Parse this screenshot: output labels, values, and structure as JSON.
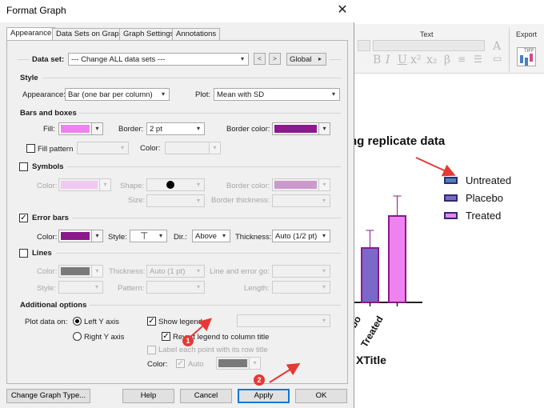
{
  "dialog": {
    "title": "Format Graph",
    "tabs": [
      "Appearance",
      "Data Sets on Graph",
      "Graph Settings",
      "Annotations"
    ],
    "dataset": {
      "label": "Data set:",
      "value": "--- Change ALL data sets ---",
      "prev": "<",
      "next": ">",
      "scope": "Global"
    },
    "style": {
      "heading": "Style",
      "appearance_label": "Appearance:",
      "appearance_value": "Bar (one bar per column)",
      "plot_label": "Plot:",
      "plot_value": "Mean with SD"
    },
    "bars": {
      "heading": "Bars and boxes",
      "fill_label": "Fill:",
      "fill_color": "#ee82ee",
      "border_label": "Border:",
      "border_value": "2 pt",
      "border_color_label": "Border color:",
      "border_color": "#8b1a8b",
      "fill_pattern_label": "Fill pattern",
      "color_label": "Color:"
    },
    "symbols": {
      "heading": "Symbols",
      "color_label": "Color:",
      "color": "#f0c8f0",
      "shape_label": "Shape:",
      "size_label": "Size:",
      "border_color_label": "Border color:",
      "border_color": "#cc99cc",
      "border_thickness_label": "Border thickness:"
    },
    "error_bars": {
      "heading": "Error bars",
      "color_label": "Color:",
      "color": "#8b1a8b",
      "style_label": "Style:",
      "dir_label": "Dir.:",
      "dir_value": "Above",
      "thickness_label": "Thickness:",
      "thickness_value": "Auto (1/2 pt)"
    },
    "lines": {
      "heading": "Lines",
      "color_label": "Color:",
      "thickness_label": "Thickness:",
      "thickness_value": "Auto (1 pt)",
      "line_error_label": "Line and error go:",
      "style_label": "Style:",
      "pattern_label": "Pattern:",
      "length_label": "Length:"
    },
    "additional": {
      "heading": "Additional options",
      "plot_on_label": "Plot data on:",
      "left_y": "Left Y axis",
      "right_y": "Right  Y axis",
      "show_legend": "Show legend",
      "revert_legend": "Revert legend to column title",
      "label_points": "Label each point with its row title",
      "color_label": "Color:",
      "auto_label": "Auto"
    },
    "buttons": {
      "change_type": "Change Graph Type...",
      "help": "Help",
      "cancel": "Cancel",
      "apply": "Apply",
      "ok": "OK"
    },
    "badges": [
      "1",
      "2"
    ]
  },
  "app": {
    "ribbon": {
      "text_group": "Text",
      "export_group": "Export",
      "export_icon_text": "TIFF"
    },
    "chart_title": "ng replicate data",
    "x_title": "XTitle",
    "legend": [
      {
        "name": "Untreated",
        "color": "#4f81bd"
      },
      {
        "name": "Placebo",
        "color": "#7b68c8"
      },
      {
        "name": "Treated",
        "color": "#ee82ee"
      }
    ]
  },
  "chart_data": {
    "type": "bar",
    "categories": [
      "Placebo",
      "Treated"
    ],
    "values": [
      68,
      108
    ],
    "error": [
      22,
      25
    ],
    "colors": [
      "#7b68c8",
      "#ee82ee"
    ],
    "title": "ng replicate data",
    "xlabel": "XTitle",
    "legend_position": "right"
  }
}
